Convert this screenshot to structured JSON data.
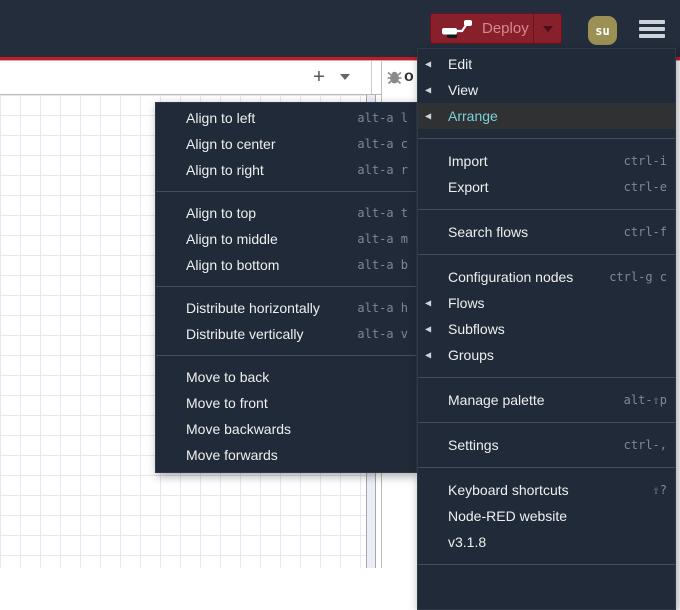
{
  "header": {
    "deploy_label": "Deploy",
    "avatar_initials": "su"
  },
  "toolbar": {
    "add_flow_label": "+",
    "flow_list_caret": "open flow list"
  },
  "sidebar": {
    "clipped_text": "o"
  },
  "icons": {
    "submenu_arrow": "◀",
    "hamburger": "menu",
    "debug_bug": "bug"
  },
  "colors": {
    "header_bg": "#232d3c",
    "accent_red": "#c01b27",
    "deploy_bg": "#87202a",
    "deploy_text": "#d5898e",
    "avatar_bg": "#9b9154",
    "menu_bg": "#202a38",
    "menu_highlight_bg": "#2f3133",
    "menu_highlight_text": "#79d2da",
    "shortcut_text": "#7f8894",
    "grid_line": "#e7e7f3"
  },
  "main_menu": {
    "trailing_separator": true,
    "sections": [
      {
        "items": [
          {
            "label": "Edit",
            "arrow": true
          },
          {
            "label": "View",
            "arrow": true
          },
          {
            "label": "Arrange",
            "arrow": true,
            "active": true
          }
        ]
      },
      {
        "items": [
          {
            "label": "Import",
            "shortcut": "ctrl-i"
          },
          {
            "label": "Export",
            "shortcut": "ctrl-e"
          }
        ]
      },
      {
        "items": [
          {
            "label": "Search flows",
            "shortcut": "ctrl-f"
          }
        ]
      },
      {
        "items": [
          {
            "label": "Configuration nodes",
            "shortcut": "ctrl-g c"
          },
          {
            "label": "Flows",
            "arrow": true
          },
          {
            "label": "Subflows",
            "arrow": true
          },
          {
            "label": "Groups",
            "arrow": true
          }
        ]
      },
      {
        "items": [
          {
            "label": "Manage palette",
            "shortcut": "alt-⇧p"
          }
        ]
      },
      {
        "items": [
          {
            "label": "Settings",
            "shortcut": "ctrl-,"
          }
        ]
      },
      {
        "items": [
          {
            "label": "Keyboard shortcuts",
            "shortcut": "⇧?"
          },
          {
            "label": "Node-RED website"
          },
          {
            "label": "v3.1.8"
          }
        ]
      }
    ]
  },
  "arrange_submenu": {
    "trailing_separator": false,
    "sections": [
      {
        "items": [
          {
            "label": "Align to left",
            "shortcut": "alt-a l"
          },
          {
            "label": "Align to center",
            "shortcut": "alt-a c"
          },
          {
            "label": "Align to right",
            "shortcut": "alt-a r"
          }
        ]
      },
      {
        "items": [
          {
            "label": "Align to top",
            "shortcut": "alt-a t"
          },
          {
            "label": "Align to middle",
            "shortcut": "alt-a m"
          },
          {
            "label": "Align to bottom",
            "shortcut": "alt-a b"
          }
        ]
      },
      {
        "items": [
          {
            "label": "Distribute horizontally",
            "shortcut": "alt-a h"
          },
          {
            "label": "Distribute vertically",
            "shortcut": "alt-a v"
          }
        ]
      },
      {
        "items": [
          {
            "label": "Move to back"
          },
          {
            "label": "Move to front"
          },
          {
            "label": "Move backwards"
          },
          {
            "label": "Move forwards"
          }
        ]
      }
    ]
  }
}
